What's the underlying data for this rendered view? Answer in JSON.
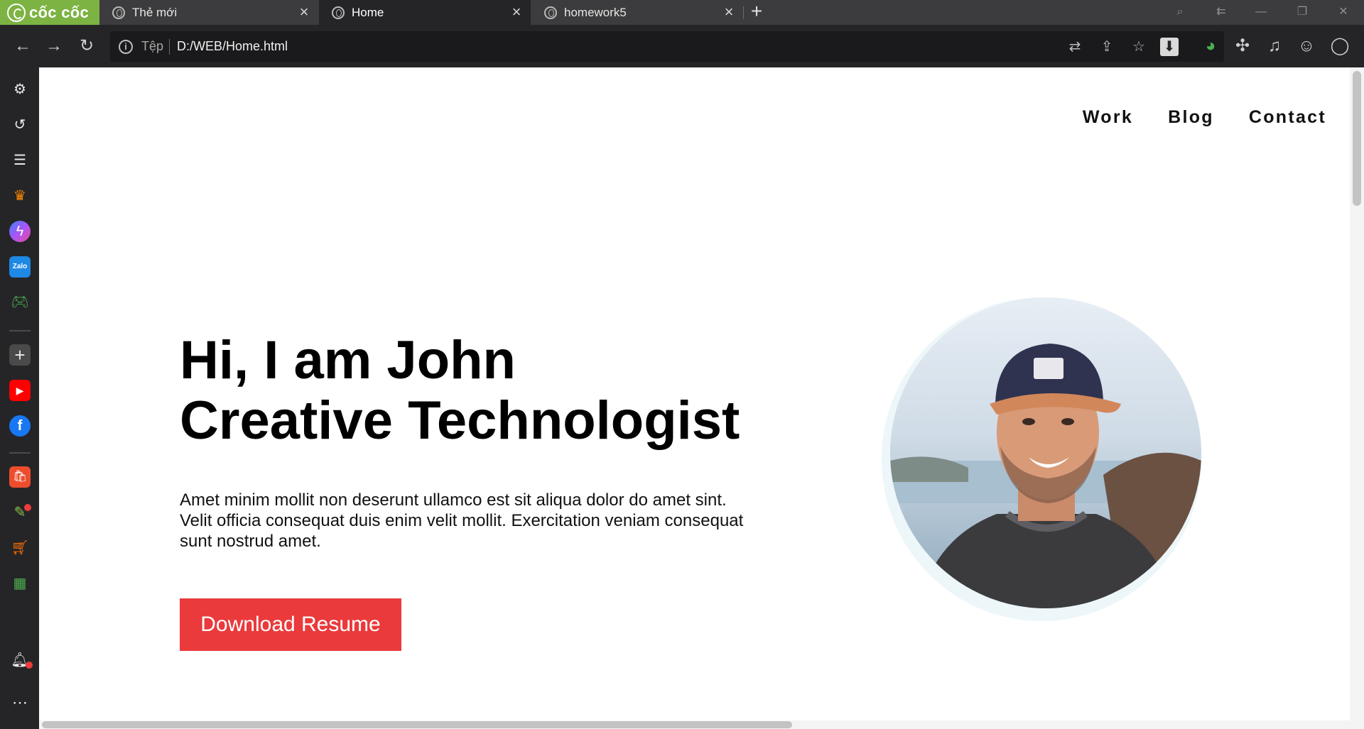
{
  "browser": {
    "brand": "cốc cốc",
    "tabs": [
      {
        "title": "Thẻ mới"
      },
      {
        "title": "Home"
      },
      {
        "title": "homework5"
      }
    ],
    "new_tab_icon": "+",
    "address": {
      "scheme_label": "Tệp",
      "url": "D:/WEB/Home.html"
    }
  },
  "page": {
    "nav": [
      "Work",
      "Blog",
      "Contact"
    ],
    "hero": {
      "line1": "Hi, I am John",
      "line2": "Creative Technologist",
      "description": "Amet minim mollit non deserunt ullamco est sit aliqua dolor do amet sint. Velit officia consequat duis enim velit mollit. Exercitation veniam consequat sunt nostrud amet.",
      "button": "Download Resume"
    }
  },
  "colors": {
    "brand_green": "#7cb342",
    "cta_red": "#ea3a3c",
    "tab_bg": "#3c3c3e",
    "toolbar_bg": "#252528"
  }
}
